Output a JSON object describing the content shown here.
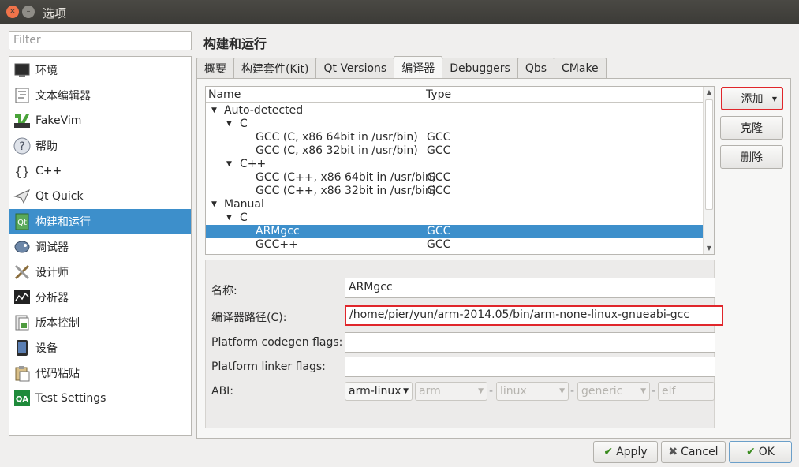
{
  "window": {
    "title": "选项",
    "close_glyph": "×",
    "min_glyph": "–"
  },
  "filter": {
    "placeholder": "Filter"
  },
  "sidebar": {
    "items": [
      {
        "label": "环境",
        "icon": "monitor-icon"
      },
      {
        "label": "文本编辑器",
        "icon": "text-editor-icon"
      },
      {
        "label": "FakeVim",
        "icon": "fakevim-icon"
      },
      {
        "label": "帮助",
        "icon": "help-icon"
      },
      {
        "label": "C++",
        "icon": "cpp-braces-icon"
      },
      {
        "label": "Qt Quick",
        "icon": "qtquick-icon"
      },
      {
        "label": "构建和运行",
        "icon": "build-run-icon"
      },
      {
        "label": "调试器",
        "icon": "debugger-icon"
      },
      {
        "label": "设计师",
        "icon": "designer-icon"
      },
      {
        "label": "分析器",
        "icon": "analyzer-icon"
      },
      {
        "label": "版本控制",
        "icon": "version-control-icon"
      },
      {
        "label": "设备",
        "icon": "device-icon"
      },
      {
        "label": "代码粘贴",
        "icon": "code-paste-icon"
      },
      {
        "label": "Test Settings",
        "icon": "qa-icon"
      }
    ],
    "selected": 6
  },
  "page": {
    "title": "构建和运行"
  },
  "tabs": [
    "概要",
    "构建套件(Kit)",
    "Qt Versions",
    "编译器",
    "Debuggers",
    "Qbs",
    "CMake"
  ],
  "active_tab": 3,
  "tree": {
    "col_name": "Name",
    "col_type": "Type",
    "rows": [
      {
        "name": "Auto-detected",
        "type": "",
        "level": 0,
        "expanded": true
      },
      {
        "name": "C",
        "type": "",
        "level": 1,
        "expanded": true
      },
      {
        "name": "GCC (C, x86 64bit in /usr/bin)",
        "type": "GCC",
        "level": 2
      },
      {
        "name": "GCC (C, x86 32bit in /usr/bin)",
        "type": "GCC",
        "level": 2
      },
      {
        "name": "C++",
        "type": "",
        "level": 1,
        "expanded": true
      },
      {
        "name": "GCC (C++, x86 64bit in /usr/bin)",
        "type": "GCC",
        "level": 2
      },
      {
        "name": "GCC (C++, x86 32bit in /usr/bin)",
        "type": "GCC",
        "level": 2
      },
      {
        "name": "Manual",
        "type": "",
        "level": 0,
        "expanded": true
      },
      {
        "name": "C",
        "type": "",
        "level": 1,
        "expanded": true
      },
      {
        "name": "ARMgcc",
        "type": "GCC",
        "level": 2,
        "selected": true
      },
      {
        "name": "GCC++",
        "type": "GCC",
        "level": 2
      }
    ]
  },
  "form": {
    "name_label": "名称:",
    "name_value": "ARMgcc",
    "path_label": "编译器路径(C):",
    "path_value": "/home/pier/yun/arm-2014.05/bin/arm-none-linux-gnueabi-gcc",
    "codegen_label": "Platform codegen flags:",
    "codegen_value": "",
    "linker_label": "Platform linker flags:",
    "linker_value": "",
    "abi_label": "ABI:",
    "abi": [
      "arm-linux",
      "arm",
      "linux",
      "generic",
      "elf"
    ],
    "abi_sep": "-"
  },
  "buttons": {
    "add": "添加",
    "clone": "克隆",
    "delete": "删除",
    "apply": "Apply",
    "cancel": "Cancel",
    "ok": "OK"
  },
  "colors": {
    "selection": "#3d8fcb",
    "highlight_box": "#e0262b"
  }
}
